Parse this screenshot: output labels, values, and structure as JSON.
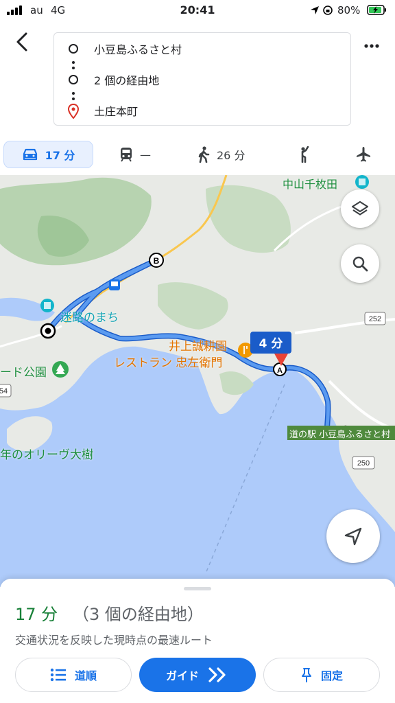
{
  "status_bar": {
    "carrier": "au",
    "network": "4G",
    "time": "20:41",
    "battery": "80%"
  },
  "header": {
    "stops": [
      {
        "label": "小豆島ふるさと村",
        "icon": "circle-icon"
      },
      {
        "label": "2 個の経由地",
        "icon": "circle-icon"
      },
      {
        "label": "土庄本町",
        "icon": "destination-pin-icon"
      }
    ]
  },
  "modes": {
    "car": "17 分",
    "transit": "—",
    "walk": "26 分"
  },
  "map": {
    "labels": {
      "nakayama": "中山千枚田",
      "meiro": "迷路のまち",
      "inoue": "井上誠耕園",
      "restaurant": "レストラン 忠左衛門",
      "park": "ード公園",
      "olive": "年のオリーヴ大樹",
      "michinoeki": "道の駅 小豆島ふるさと村",
      "route_252": "252",
      "route_250": "250",
      "route_254": "54"
    },
    "callout": "4 分",
    "marker_a": "A",
    "marker_b": "B"
  },
  "summary": {
    "time": "17 分",
    "via": "（3 個の経由地）",
    "description": "交通状況を反映した現時点の最速ルート"
  },
  "buttons": {
    "directions": "道順",
    "guide": "ガイド",
    "pin": "固定"
  },
  "colors": {
    "accent": "#1a73e8",
    "route": "#4285f4",
    "time_green": "#188038",
    "water": "#aecbfa",
    "land": "#e8eae6",
    "forest": "#b7d3b0"
  }
}
